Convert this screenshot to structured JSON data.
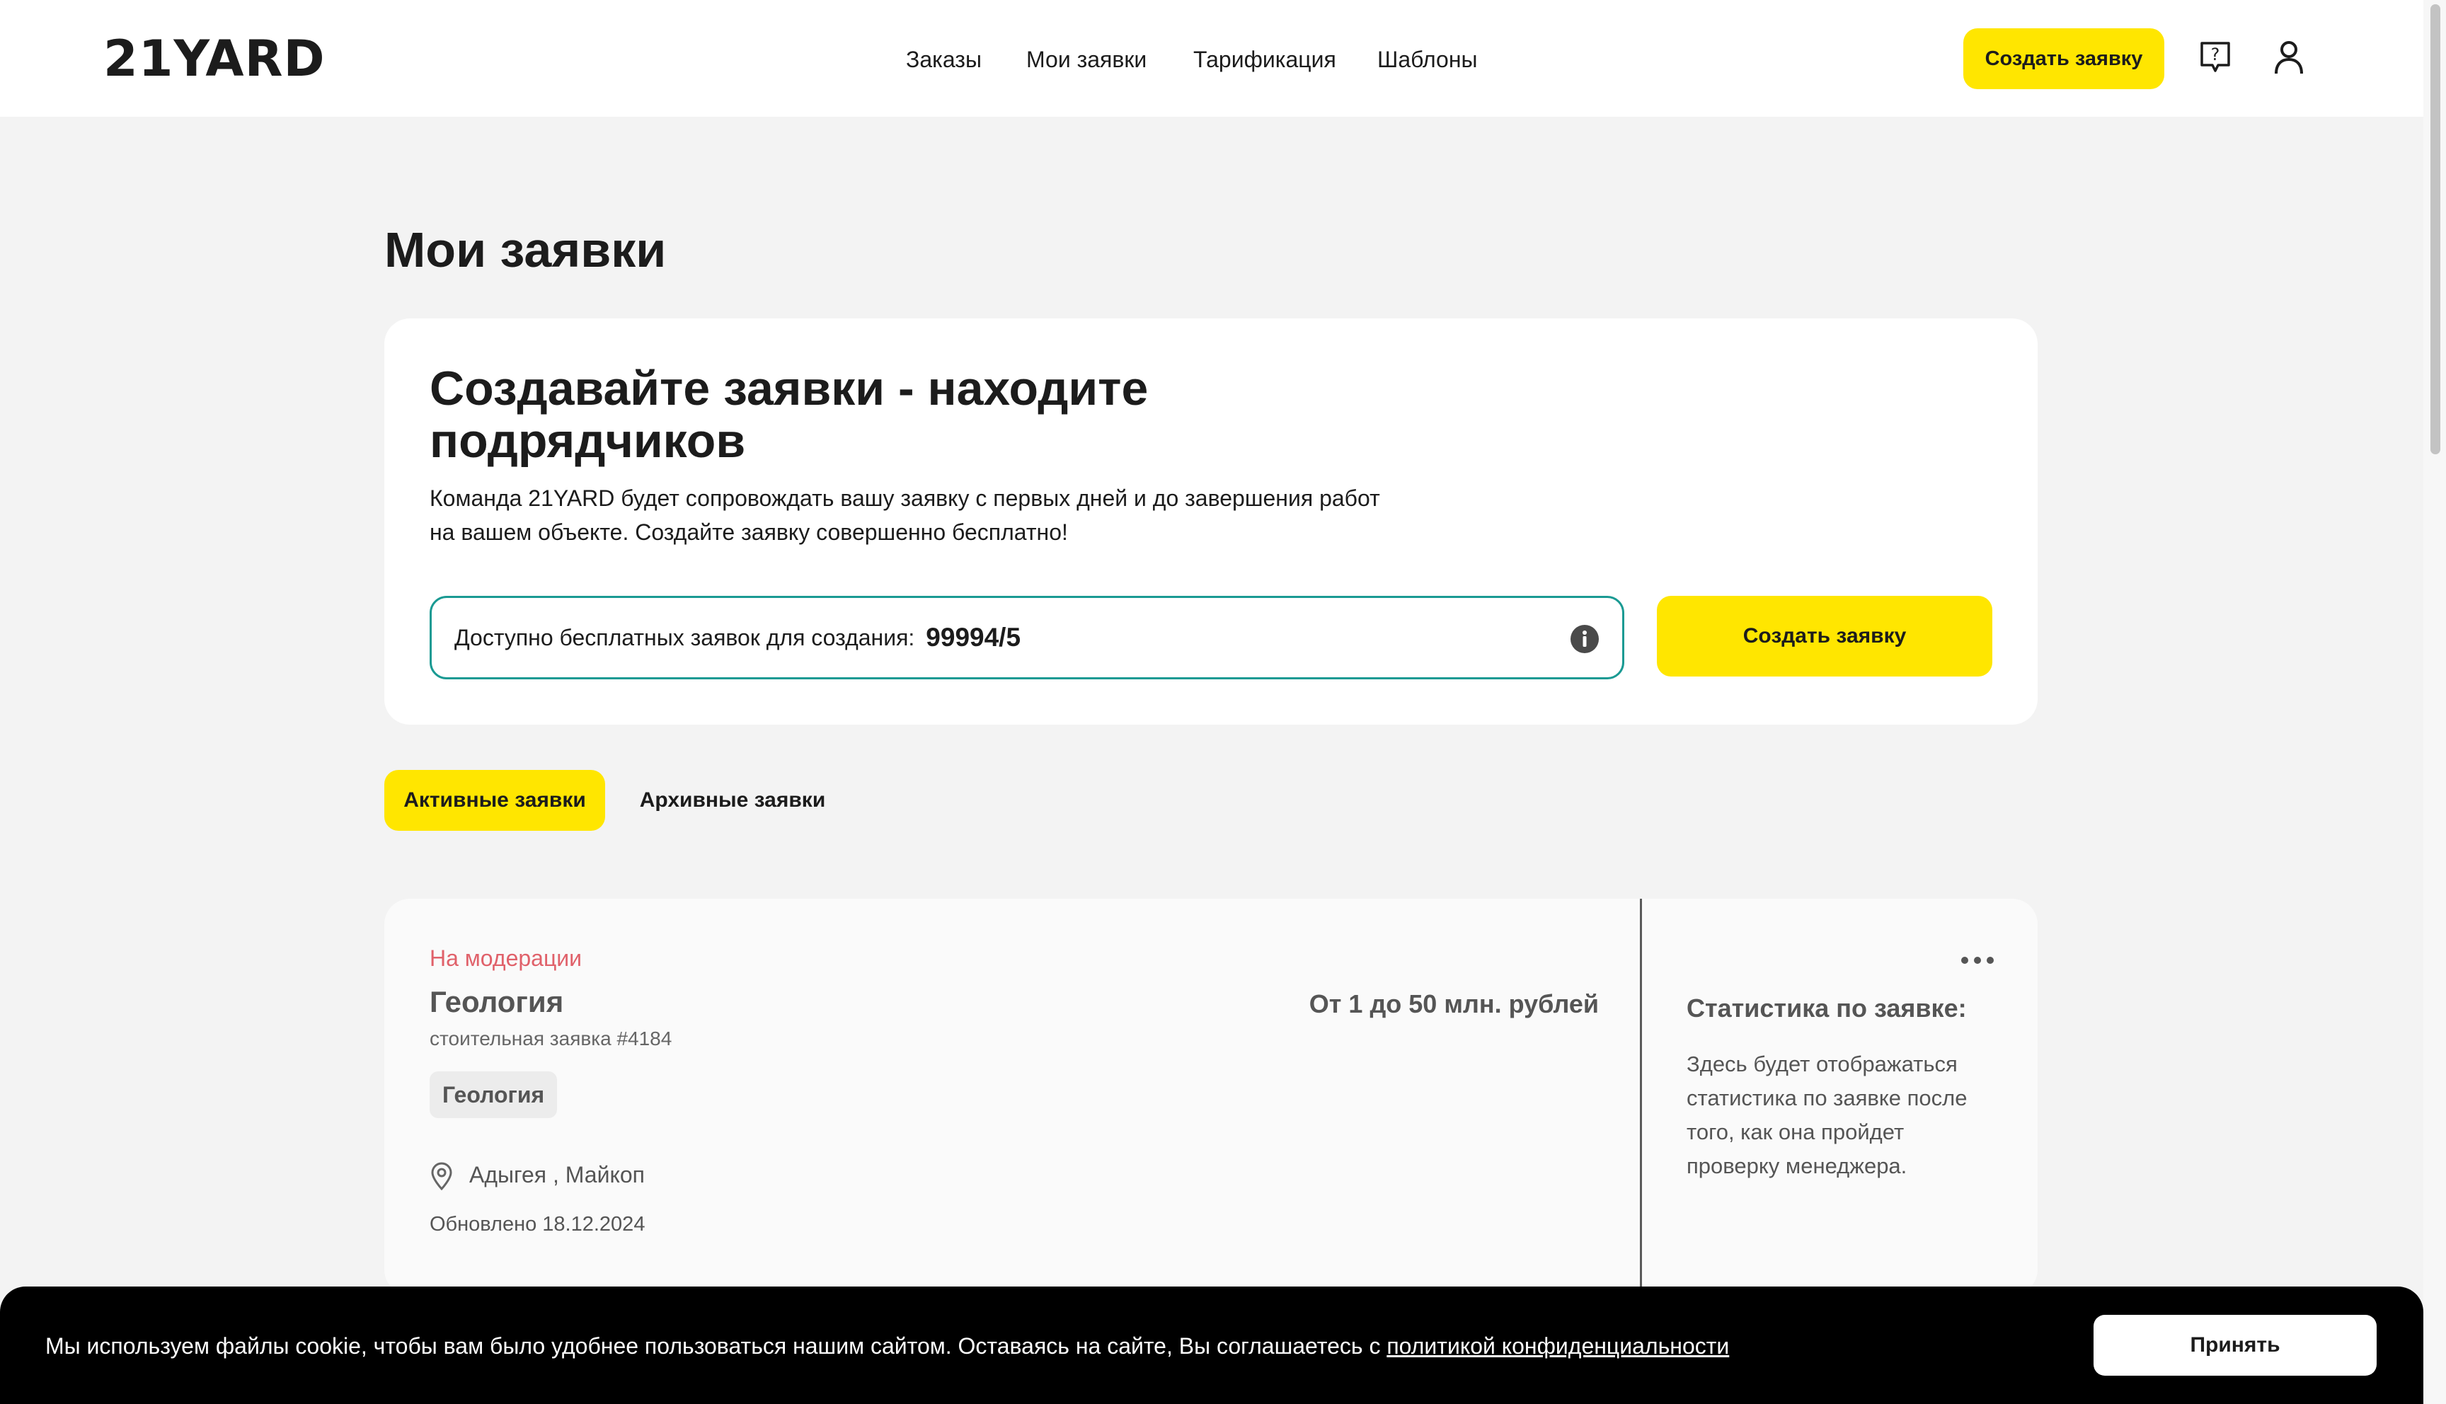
{
  "header": {
    "logo": "21YARD",
    "nav": [
      "Заказы",
      "Мои заявки",
      "Тарификация",
      "Шаблоны"
    ],
    "create_button": "Создать заявку",
    "help_icon": "help-chat-icon",
    "user_icon": "user-icon"
  },
  "page_title": "Мои заявки",
  "hero": {
    "title": "Создавайте заявки - находите подрядчиков",
    "text": "Команда 21YARD будет сопровождать вашу заявку с первых дней и до завершения работ на вашем объекте. Создайте заявку совершенно бесплатно!",
    "quota_label": "Доступно бесплатных заявок для создания:",
    "quota_value": "99994/5",
    "button": "Создать заявку",
    "accent_color": "#ffe600",
    "border_color": "#1a9a93"
  },
  "tabs": [
    "Активные заявки",
    "Архивные заявки"
  ],
  "card": {
    "status": "На модерации",
    "status_color": "#e0616a",
    "title": "Геология",
    "subtitle": "стоительная заявка #4184",
    "price": "От 1 до 50 млн. рублей",
    "tag": "Геология",
    "location": "Адыгея , Майкоп",
    "updated": "Обновлено 18.12.2024",
    "stats_title": "Статистика по заявке:",
    "stats_text": "Здесь будет отображаться статистика по заявке после того, как она пройдет проверку менеджера."
  },
  "cookie": {
    "text": "Мы используем файлы cookie, чтобы вам было удобнее пользоваться нашим сайтом. Оставаясь на сайте, Вы соглашаетесь с",
    "link": "политикой конфиденциальности",
    "button": "Принять"
  }
}
